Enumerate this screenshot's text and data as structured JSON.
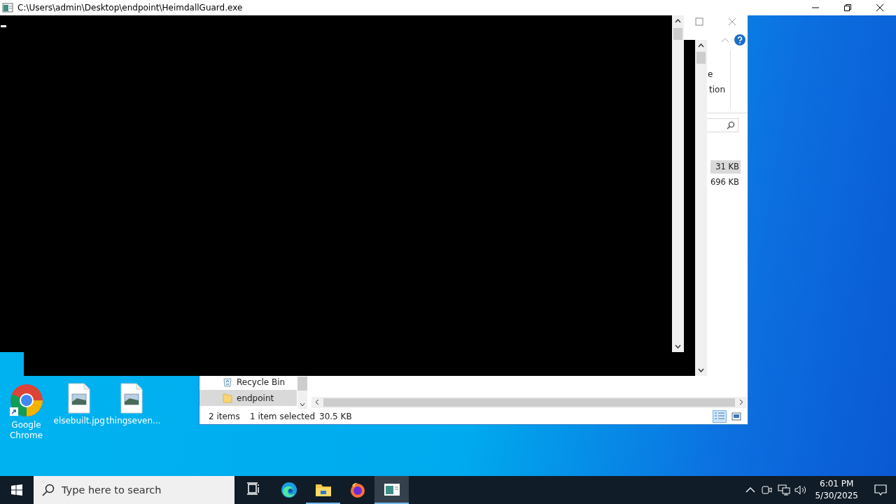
{
  "console_window": {
    "title": "C:\\Users\\admin\\Desktop\\endpoint\\HeimdallGuard.exe"
  },
  "explorer_window": {
    "ribbon_fragments": [
      "e",
      "tion"
    ],
    "file_sizes": [
      {
        "text": "31 KB",
        "selected": true
      },
      {
        "text": "696 KB",
        "selected": false
      }
    ],
    "nav_items": [
      {
        "label": "Recycle Bin",
        "kind": "recycle",
        "selected": false
      },
      {
        "label": "endpoint",
        "kind": "folder",
        "selected": true
      }
    ],
    "status_bar": {
      "item_count": "2 items",
      "selection": "1 item selected",
      "size": "30.5 KB"
    }
  },
  "desktop_icons": [
    {
      "label": "Google Chrome",
      "kind": "chrome"
    },
    {
      "label": "elsebuilt.jpg",
      "kind": "image"
    },
    {
      "label": "thingseven...",
      "kind": "image"
    }
  ],
  "taskbar": {
    "search": {
      "placeholder": "Type here to search"
    },
    "apps": [
      {
        "kind": "task-view",
        "running": false,
        "selected": false
      },
      {
        "kind": "edge",
        "running": false,
        "selected": false
      },
      {
        "kind": "explorer",
        "running": true,
        "selected": false
      },
      {
        "kind": "firefox",
        "running": false,
        "selected": false
      },
      {
        "kind": "console",
        "running": true,
        "selected": true
      }
    ],
    "clock": {
      "time": "6:01 PM",
      "date": "5/30/2025"
    }
  }
}
